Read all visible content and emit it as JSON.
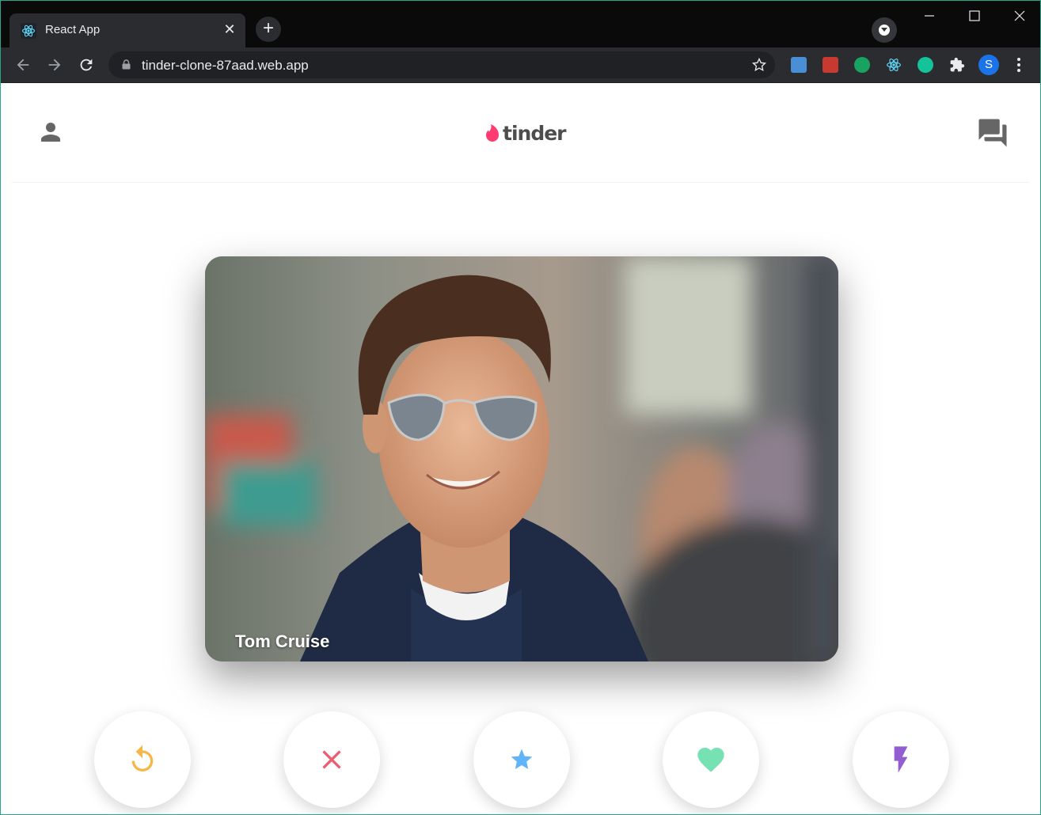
{
  "browser": {
    "tab_title": "React App",
    "url": "tinder-clone-87aad.web.app",
    "profile_initial": "S"
  },
  "app": {
    "logo_text": "tinder",
    "brand_color": "#fe3c72"
  },
  "card": {
    "name": "Tom Cruise"
  },
  "actions": {
    "repeat_color": "#f5b748",
    "left_color": "#ec5e6f",
    "star_color": "#62b4f9",
    "right_color": "#76e2b3",
    "flash_color": "#915dd1"
  }
}
